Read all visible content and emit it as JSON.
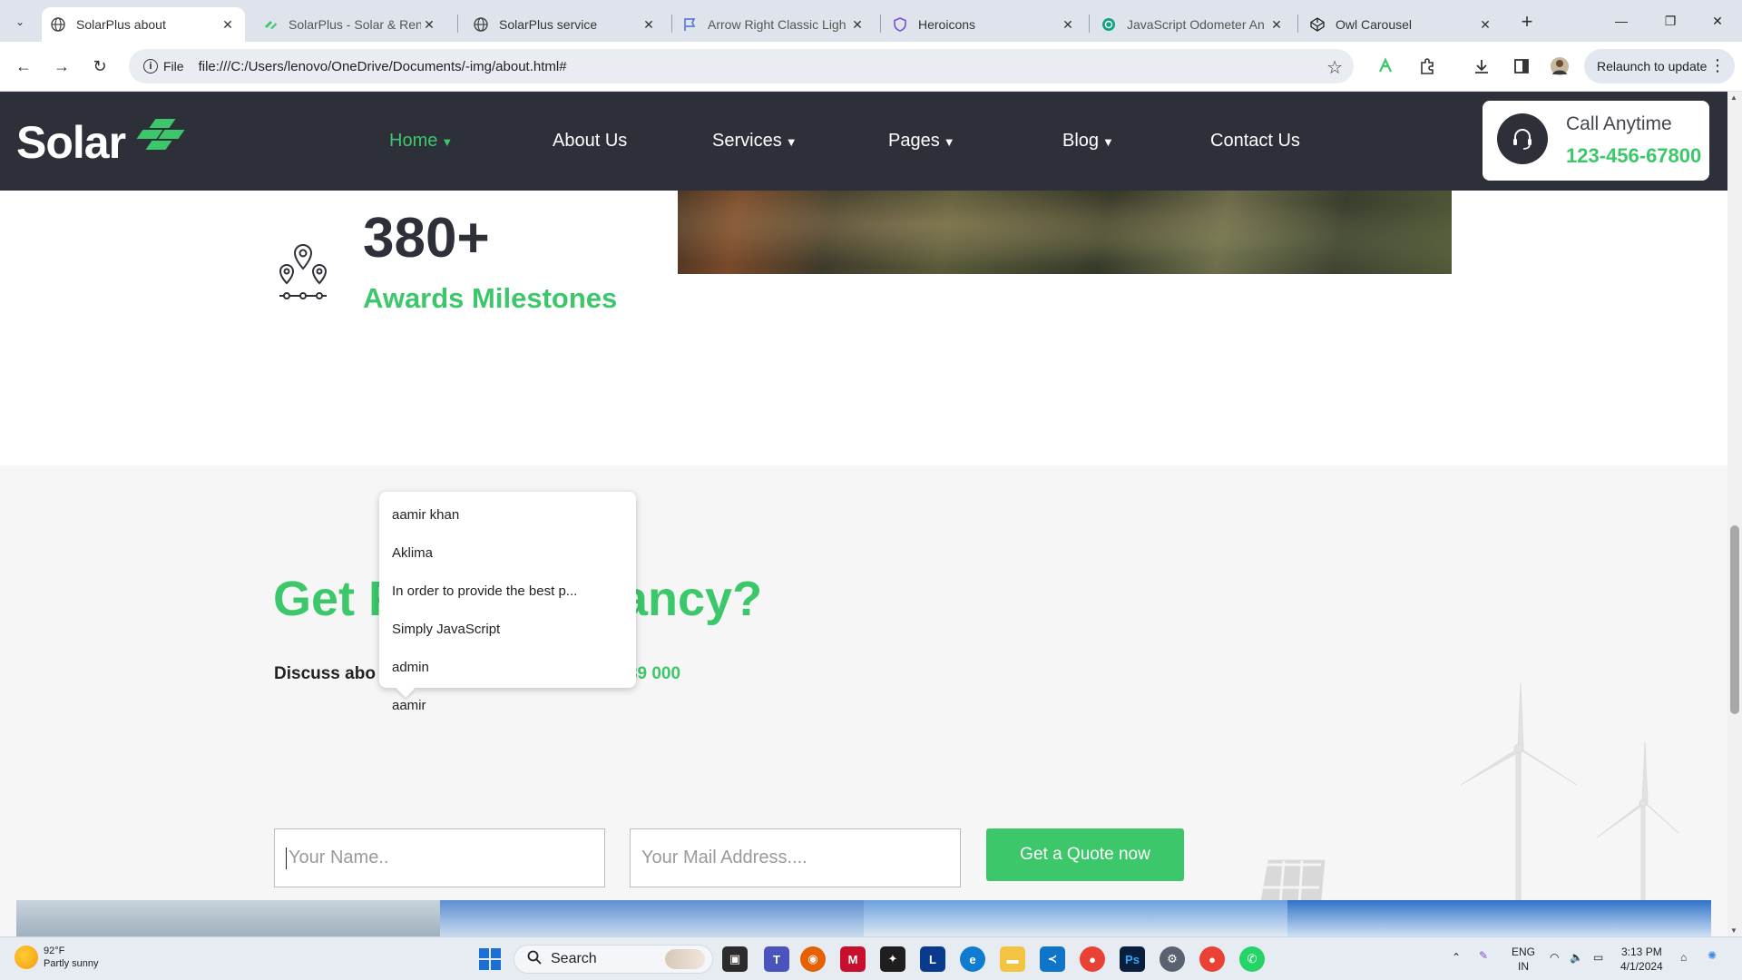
{
  "browser": {
    "tabs": [
      {
        "title": "SolarPlus about",
        "active": true
      },
      {
        "title": "SolarPlus - Solar & Rene"
      },
      {
        "title": "SolarPlus service"
      },
      {
        "title": "Arrow Right Classic Ligh"
      },
      {
        "title": "Heroicons"
      },
      {
        "title": "JavaScript Odometer An"
      },
      {
        "title": "Owl Carousel"
      }
    ],
    "site_chip": "File",
    "url": "file:///C:/Users/lenovo/OneDrive/Documents/-img/about.html#",
    "relaunch_label": "Relaunch to update"
  },
  "site": {
    "logo": "Solar",
    "nav": [
      {
        "label": "Home",
        "dropdown": true,
        "active": true
      },
      {
        "label": "About Us",
        "dropdown": false
      },
      {
        "label": "Services",
        "dropdown": true
      },
      {
        "label": "Pages",
        "dropdown": true
      },
      {
        "label": "Blog",
        "dropdown": true
      },
      {
        "label": "Contact Us",
        "dropdown": false
      }
    ],
    "call": {
      "label": "Call Anytime",
      "number": "123-456-67800"
    }
  },
  "stat": {
    "number": "380+",
    "label": "Awards Milestones"
  },
  "cta": {
    "title": "Get F",
    "title_tail": "ltancy?",
    "subtitle": "Discuss abo",
    "subtitle_phone": "89 000",
    "name_placeholder": "Your Name..",
    "email_placeholder": "Your Mail Address....",
    "button": "Get a Quote now"
  },
  "autocomplete": [
    "aamir khan",
    "Aklima",
    "In order to provide the best p...",
    "Simply JavaScript",
    "admin",
    "aamir"
  ],
  "taskbar": {
    "weather_temp": "92°F",
    "weather_desc": "Partly sunny",
    "search": "Search",
    "lang_top": "ENG",
    "lang_bottom": "IN",
    "time": "3:13 PM",
    "date": "4/1/2024"
  },
  "colors": {
    "accent": "#3cc86a",
    "header": "#2d3038"
  }
}
